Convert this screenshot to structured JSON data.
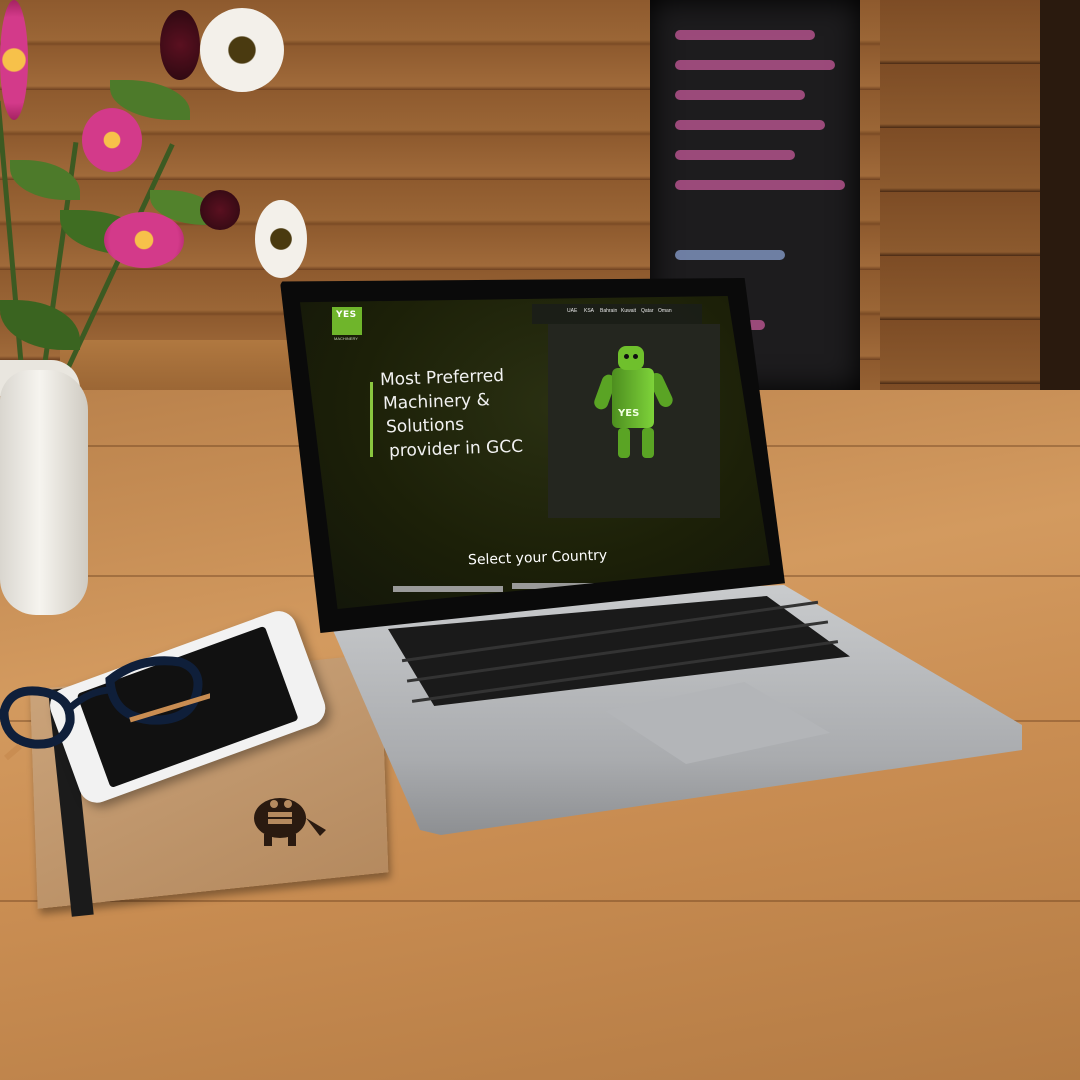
{
  "website": {
    "logo": {
      "mark": "YES",
      "subtitle": "MACHINERY"
    },
    "nav": [
      "UAE",
      "KSA",
      "Bahrain",
      "Kuwait",
      "Qatar",
      "Oman"
    ],
    "hero_lines": [
      "Most Preferred",
      "Machinery &",
      "Solutions",
      "provider in GCC"
    ],
    "mascot_label": "YES",
    "country_prompt": "Select your Country"
  },
  "colors": {
    "brand_green": "#6fb52b",
    "screen_background": "#1c2008",
    "accent_line": "#8ac63f"
  },
  "icons": {
    "notebook_mark": "monster-icon",
    "mascot": "robot-icon"
  }
}
